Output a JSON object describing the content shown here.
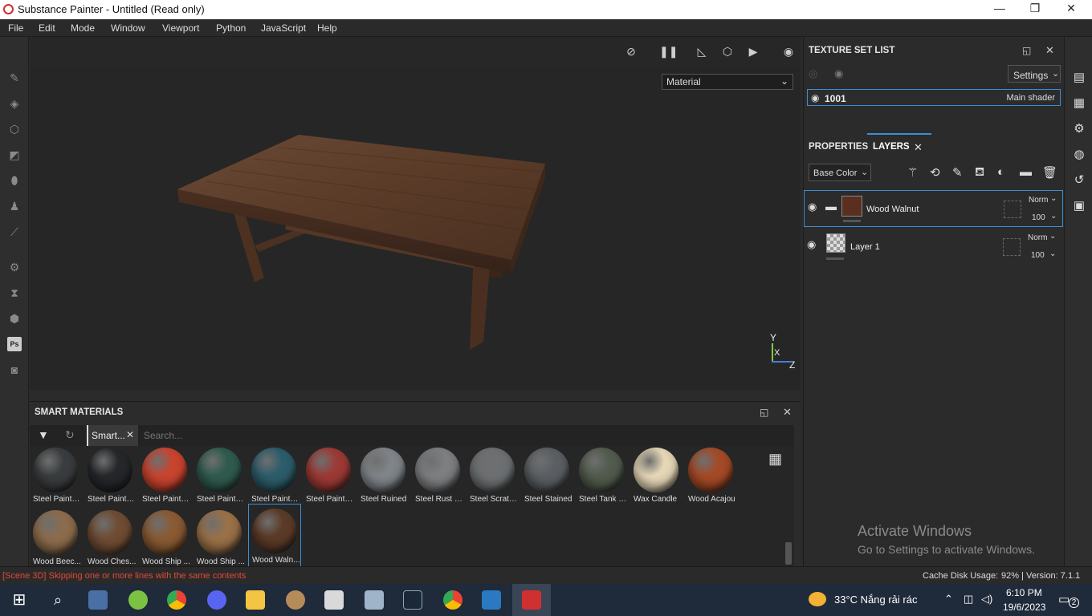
{
  "window": {
    "title": "Substance Painter - Untitled (Read only)",
    "minimize": "—",
    "maximize": "❐",
    "close": "✕"
  },
  "menu": [
    "File",
    "Edit",
    "Mode",
    "Window",
    "Viewport",
    "Python",
    "JavaScript",
    "Help"
  ],
  "viewport": {
    "material_select": "Material",
    "axis_y": "Y",
    "axis_x": "X",
    "axis_z": "Z"
  },
  "smart_materials": {
    "title": "SMART MATERIALS",
    "filter_chip": "Smart...",
    "search_placeholder": "Search...",
    "items": [
      {
        "label": "Steel Painte...",
        "color": "#3a3d3f"
      },
      {
        "label": "Steel Painte...",
        "color": "#25272a"
      },
      {
        "label": "Steel Painte...",
        "color": "#c9442f"
      },
      {
        "label": "Steel Painte...",
        "color": "#2f5b4e"
      },
      {
        "label": "Steel Painte...",
        "color": "#2c5d6a"
      },
      {
        "label": "Steel Painte...",
        "color": "#9c3a35"
      },
      {
        "label": "Steel Ruined",
        "color": "#80858a"
      },
      {
        "label": "Steel Rust S...",
        "color": "#7d7f82"
      },
      {
        "label": "Steel Scratc...",
        "color": "#6d7072"
      },
      {
        "label": "Steel Stained",
        "color": "#5b5f63"
      },
      {
        "label": "Steel Tank P...",
        "color": "#525b4d"
      },
      {
        "label": "Wax Candle",
        "color": "#e6d7b7"
      },
      {
        "label": "Wood Acajou",
        "color": "#a54a26"
      },
      {
        "label": "Wood Beec...",
        "color": "#8d6c4c"
      },
      {
        "label": "Wood Ches...",
        "color": "#6f4c33"
      },
      {
        "label": "Wood Ship ...",
        "color": "#8a5a33"
      },
      {
        "label": "Wood Ship ...",
        "color": "#9a7148"
      },
      {
        "label": "Wood Waln...",
        "color": "#5b3b28"
      }
    ]
  },
  "texture_set_list": {
    "title": "TEXTURE SET LIST",
    "settings": "Settings",
    "set_name": "1001",
    "shader": "Main shader"
  },
  "layers_panel": {
    "tab_properties": "PROPERTIES",
    "tab_layers": "LAYERS",
    "channel": "Base Color",
    "layers": [
      {
        "name": "Wood Walnut",
        "blend": "Norm",
        "opacity": "100"
      },
      {
        "name": "Layer 1",
        "blend": "Norm",
        "opacity": "100"
      }
    ]
  },
  "watermark": {
    "line1": "Activate Windows",
    "line2": "Go to Settings to activate Windows."
  },
  "status": {
    "message": "[Scene 3D] Skipping one or more lines with the same contents",
    "cache": "Cache Disk Usage:",
    "cache_value": "92% | Version: 7.1.1"
  },
  "taskbar": {
    "weather": "33°C  Nắng rải rác",
    "time": "6:10 PM",
    "date": "19/6/2023",
    "notif_count": "2"
  }
}
